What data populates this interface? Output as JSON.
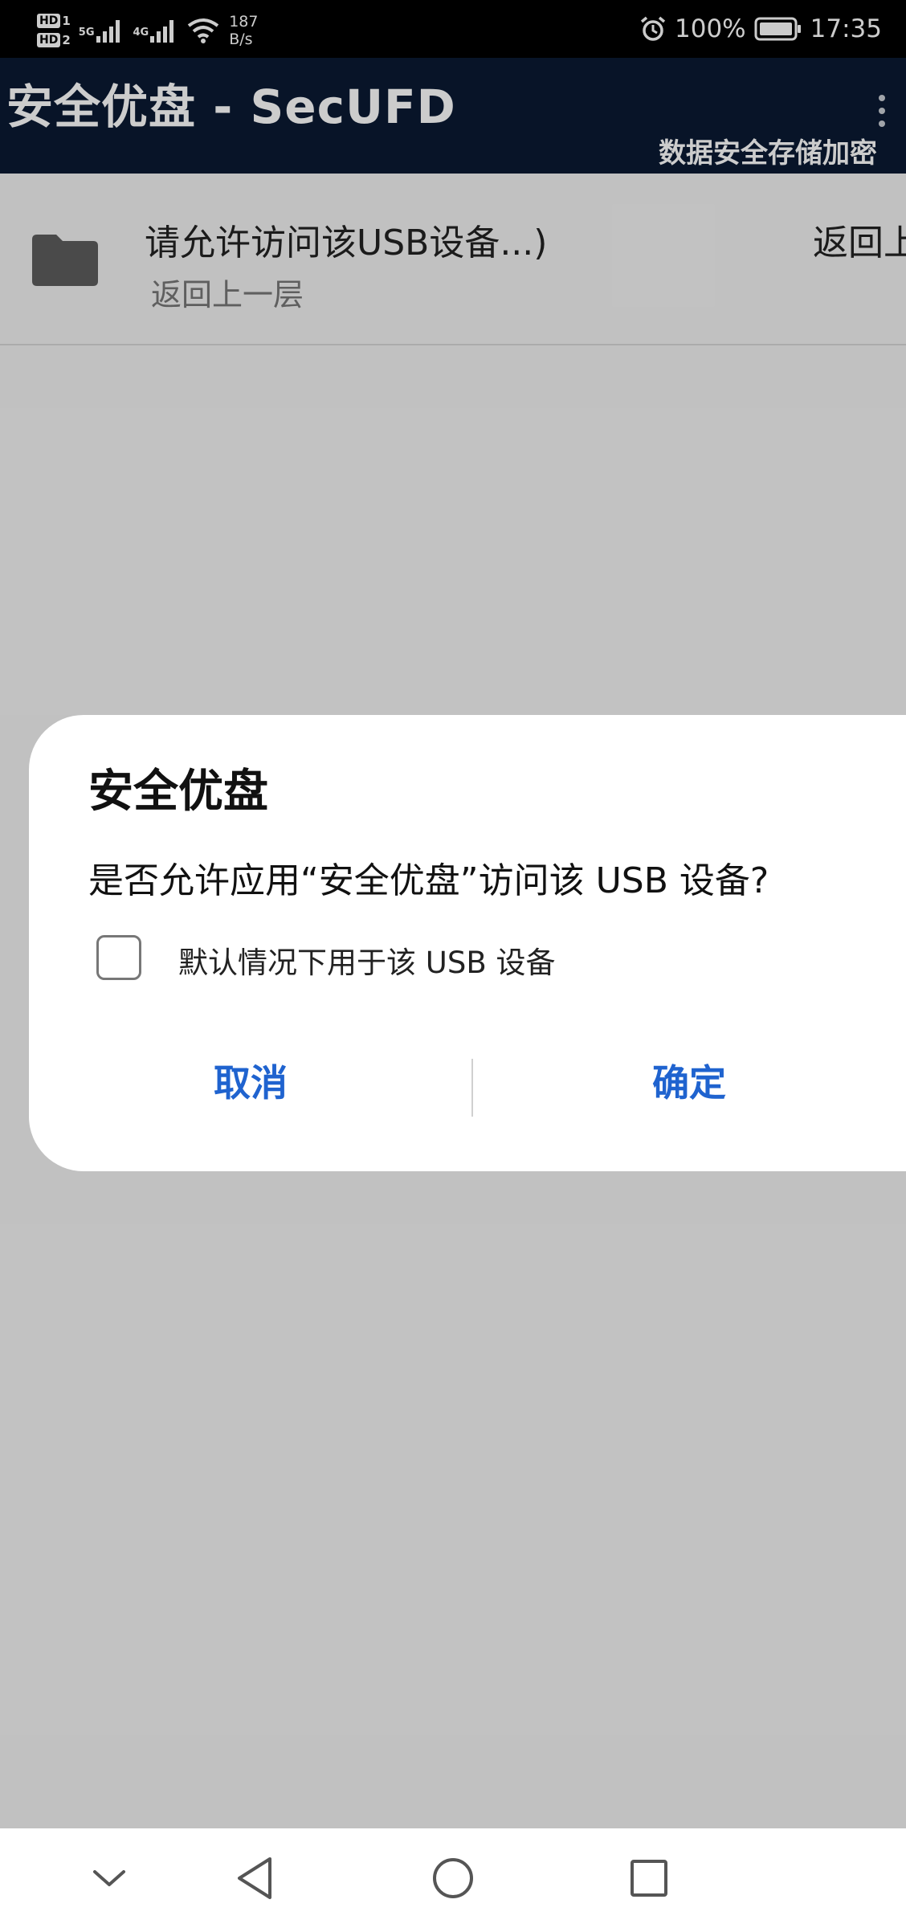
{
  "status_bar": {
    "sim1": "HD",
    "sim1_slot": "1",
    "sim2": "HD",
    "sim2_slot": "2",
    "network_1": "5G",
    "network_2": "4G",
    "speed_value": "187",
    "speed_unit": "B/s",
    "battery": "100%",
    "time": "17:35",
    "icons": [
      "signal-icon",
      "wifi-icon",
      "alarm-icon",
      "battery-icon"
    ]
  },
  "app_bar": {
    "title": "安全优盘 - SecUFD",
    "subtitle": "数据安全存储加密",
    "menu_icon": "more-vertical-icon",
    "background_color": "#0b1a33"
  },
  "file_list": {
    "items": [
      {
        "icon": "folder-icon",
        "title": "请允许访问该USB设备...)",
        "subtitle": "返回上一层",
        "right_text": "返回上一层"
      }
    ]
  },
  "dialog": {
    "title": "安全优盘",
    "message": "是否允许应用“安全优盘”访问该 USB 设备?",
    "checkbox_label": "默认情况下用于该 USB 设备",
    "checkbox_checked": false,
    "cancel_label": "取消",
    "confirm_label": "确定",
    "accent_color": "#1f63cf"
  },
  "nav_bar": {
    "buttons": [
      "chevron-down-icon",
      "back-icon",
      "home-icon",
      "recents-icon"
    ]
  }
}
